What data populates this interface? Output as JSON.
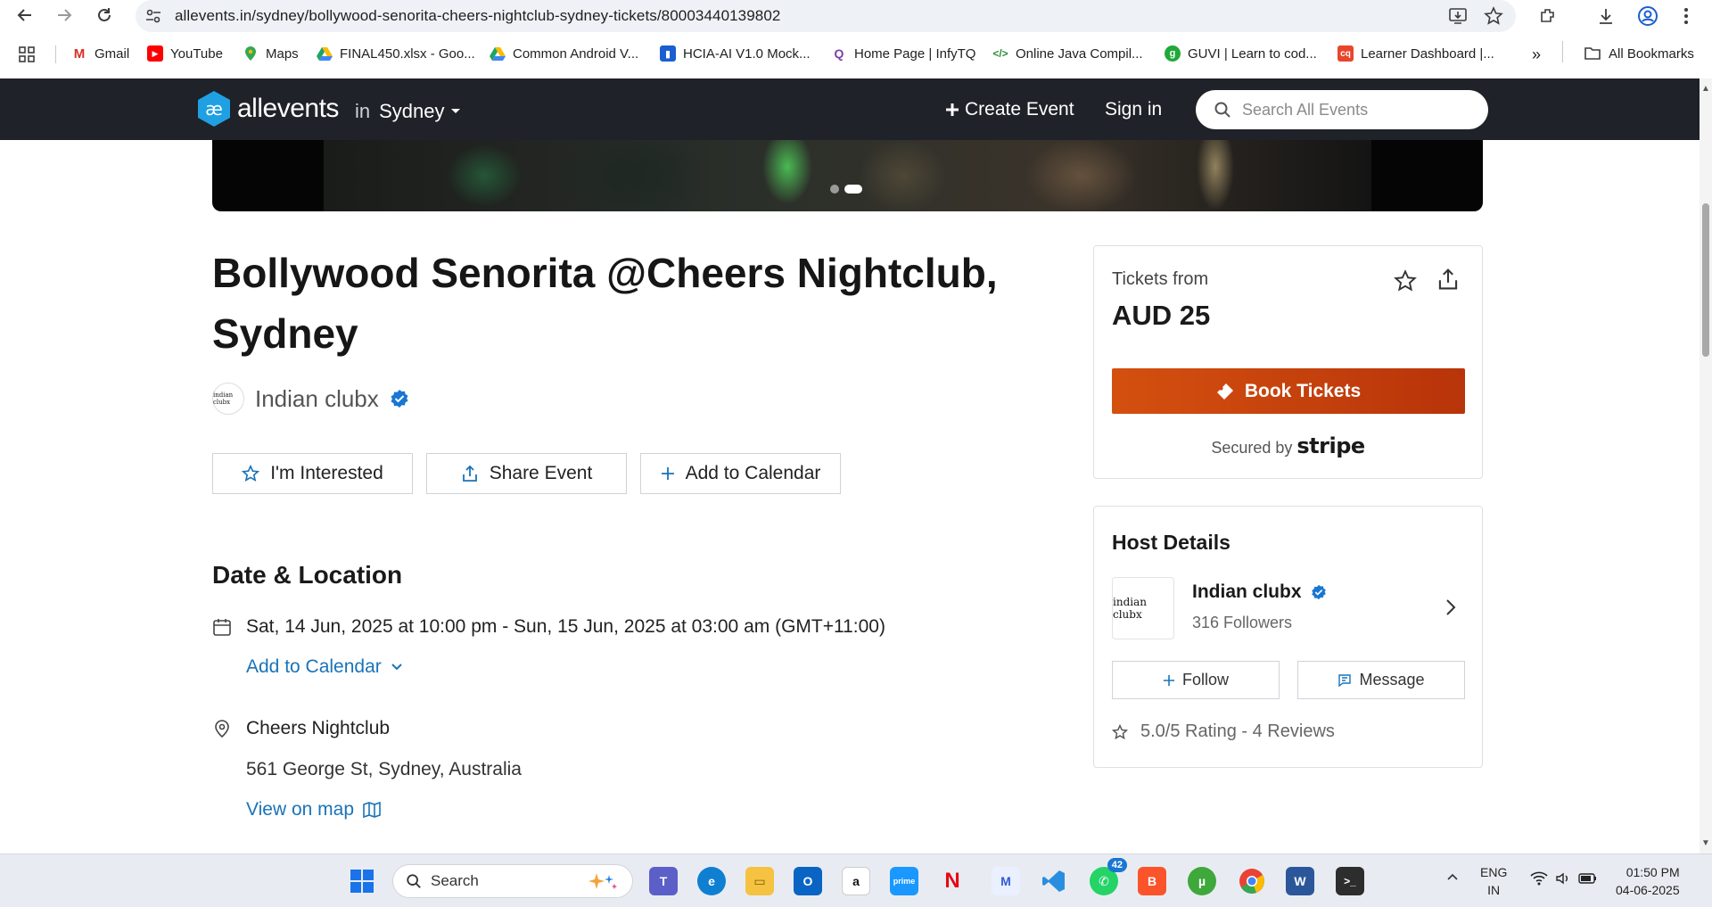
{
  "browser": {
    "url": "allevents.in/sydney/bollywood-senorita-cheers-nightclub-sydney-tickets/80003440139802",
    "bookmarks": [
      {
        "label": "Gmail",
        "icon": "gmail-icon"
      },
      {
        "label": "YouTube",
        "icon": "youtube-icon"
      },
      {
        "label": "Maps",
        "icon": "maps-icon"
      },
      {
        "label": "FINAL450.xlsx - Goo...",
        "icon": "google-drive-icon"
      },
      {
        "label": "Common Android V...",
        "icon": "google-drive-icon"
      },
      {
        "label": "HCIA-AI V1.0 Mock...",
        "icon": "huawei-icon"
      },
      {
        "label": "Home Page | InfyTQ",
        "icon": "infytq-icon"
      },
      {
        "label": "Online Java Compil...",
        "icon": "code-icon"
      },
      {
        "label": "GUVI | Learn to cod...",
        "icon": "guvi-icon"
      },
      {
        "label": "Learner Dashboard |...",
        "icon": "cq-icon"
      }
    ],
    "more_label": "»",
    "all_bookmarks": "All Bookmarks"
  },
  "site": {
    "logo_text": "allevents",
    "city_prefix": "in",
    "city": "Sydney",
    "create_event": "Create Event",
    "sign_in": "Sign in",
    "search_placeholder": "Search All Events"
  },
  "event": {
    "title": "Bollywood Senorita @Cheers Nightclub, Sydney",
    "organizer": "Indian clubx",
    "organizer_avatar_text": "indian clubx",
    "carousel": {
      "count": 2,
      "active": 2
    },
    "actions": {
      "interested": "I'm Interested",
      "share": "Share Event",
      "calendar": "Add to Calendar"
    },
    "date_location_heading": "Date & Location",
    "datetime": "Sat, 14 Jun, 2025 at 10:00 pm - Sun, 15 Jun, 2025 at 03:00 am (GMT+11:00)",
    "add_to_calendar_link": "Add to Calendar",
    "venue": "Cheers Nightclub",
    "address": "561 George St, Sydney, Australia",
    "view_on_map": "View on map"
  },
  "tickets": {
    "from_label": "Tickets from",
    "price": "AUD 25",
    "book_label": "Book Tickets",
    "secured_by": "Secured by",
    "provider": "stripe"
  },
  "host": {
    "heading": "Host Details",
    "name": "Indian clubx",
    "logo_text": "indian clubx",
    "followers": "316 Followers",
    "follow": "Follow",
    "message": "Message",
    "rating": "5.0/5 Rating - 4 Reviews"
  },
  "taskbar": {
    "search_label": "Search",
    "whatsapp_badge": "42",
    "lang_top": "ENG",
    "lang_bottom": "IN",
    "time": "01:50 PM",
    "date": "04-06-2025"
  },
  "colors": {
    "header_bg": "#1f2228",
    "accent_blue": "#1a73b8",
    "book_orange": "#c8420c",
    "verified_blue": "#1976d2"
  }
}
